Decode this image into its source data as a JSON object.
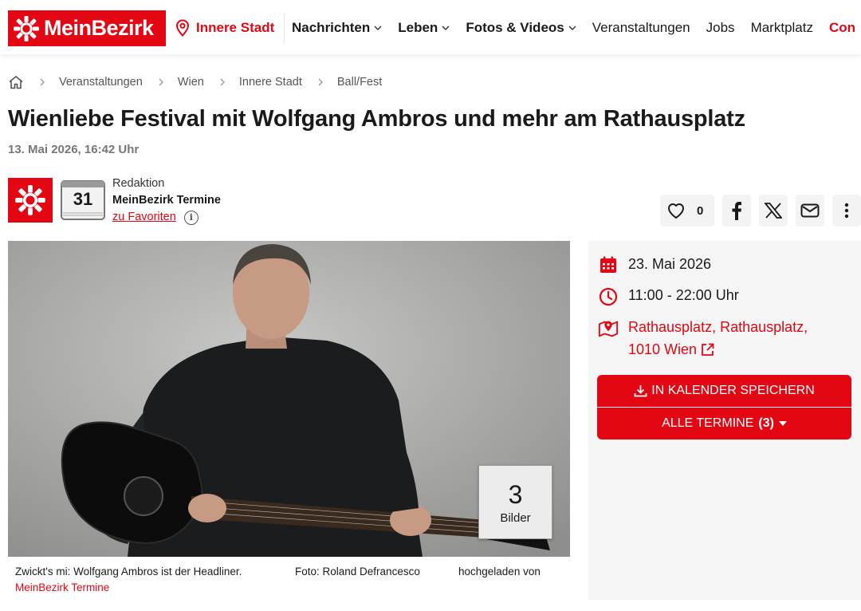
{
  "header": {
    "logo_text": "MeinBezirk",
    "location": "Innere Stadt",
    "nav": [
      {
        "label": "Nachrichten",
        "bold": true,
        "chevron": true
      },
      {
        "label": "Leben",
        "bold": true,
        "chevron": true
      },
      {
        "label": "Fotos & Videos",
        "bold": true,
        "chevron": true
      },
      {
        "label": "Veranstaltungen",
        "bold": false,
        "chevron": false
      },
      {
        "label": "Jobs",
        "bold": false,
        "chevron": false
      },
      {
        "label": "Marktplatz",
        "bold": false,
        "chevron": false
      },
      {
        "label": "Con",
        "bold": true,
        "chevron": false
      }
    ]
  },
  "breadcrumb": [
    "Veranstaltungen",
    "Wien",
    "Innere Stadt",
    "Ball/Fest"
  ],
  "article": {
    "title": "Wienliebe Festival mit Wolfgang Ambros und mehr am Rathausplatz",
    "date": "13. Mai 2026, 16:42 Uhr"
  },
  "author": {
    "calendar_day": "31",
    "role": "Redaktion",
    "name": "MeinBezirk Termine",
    "favorite_link": "zu Favoriten"
  },
  "actions": {
    "like_count": "0"
  },
  "photo": {
    "badge_count": "3",
    "badge_label": "Bilder",
    "caption": "Zwickt's mi: Wolfgang Ambros ist der Headliner.",
    "credit": "Foto: Roland Defrancesco",
    "uploaded_by_label": "hochgeladen von",
    "uploaded_by": "MeinBezirk Termine"
  },
  "event": {
    "date": "23. Mai 2026",
    "time": "11:00 - 22:00 Uhr",
    "location_line1": "Rathausplatz, Rathausplatz,",
    "location_line2": "1010 Wien",
    "calendar_button": "IN KALENDER SPEICHERN",
    "all_dates_button": "ALLE TERMINE",
    "all_dates_count": "(3)"
  },
  "colors": {
    "brand_red": "#e30613",
    "sidebar_bg": "#f5f5f5"
  }
}
